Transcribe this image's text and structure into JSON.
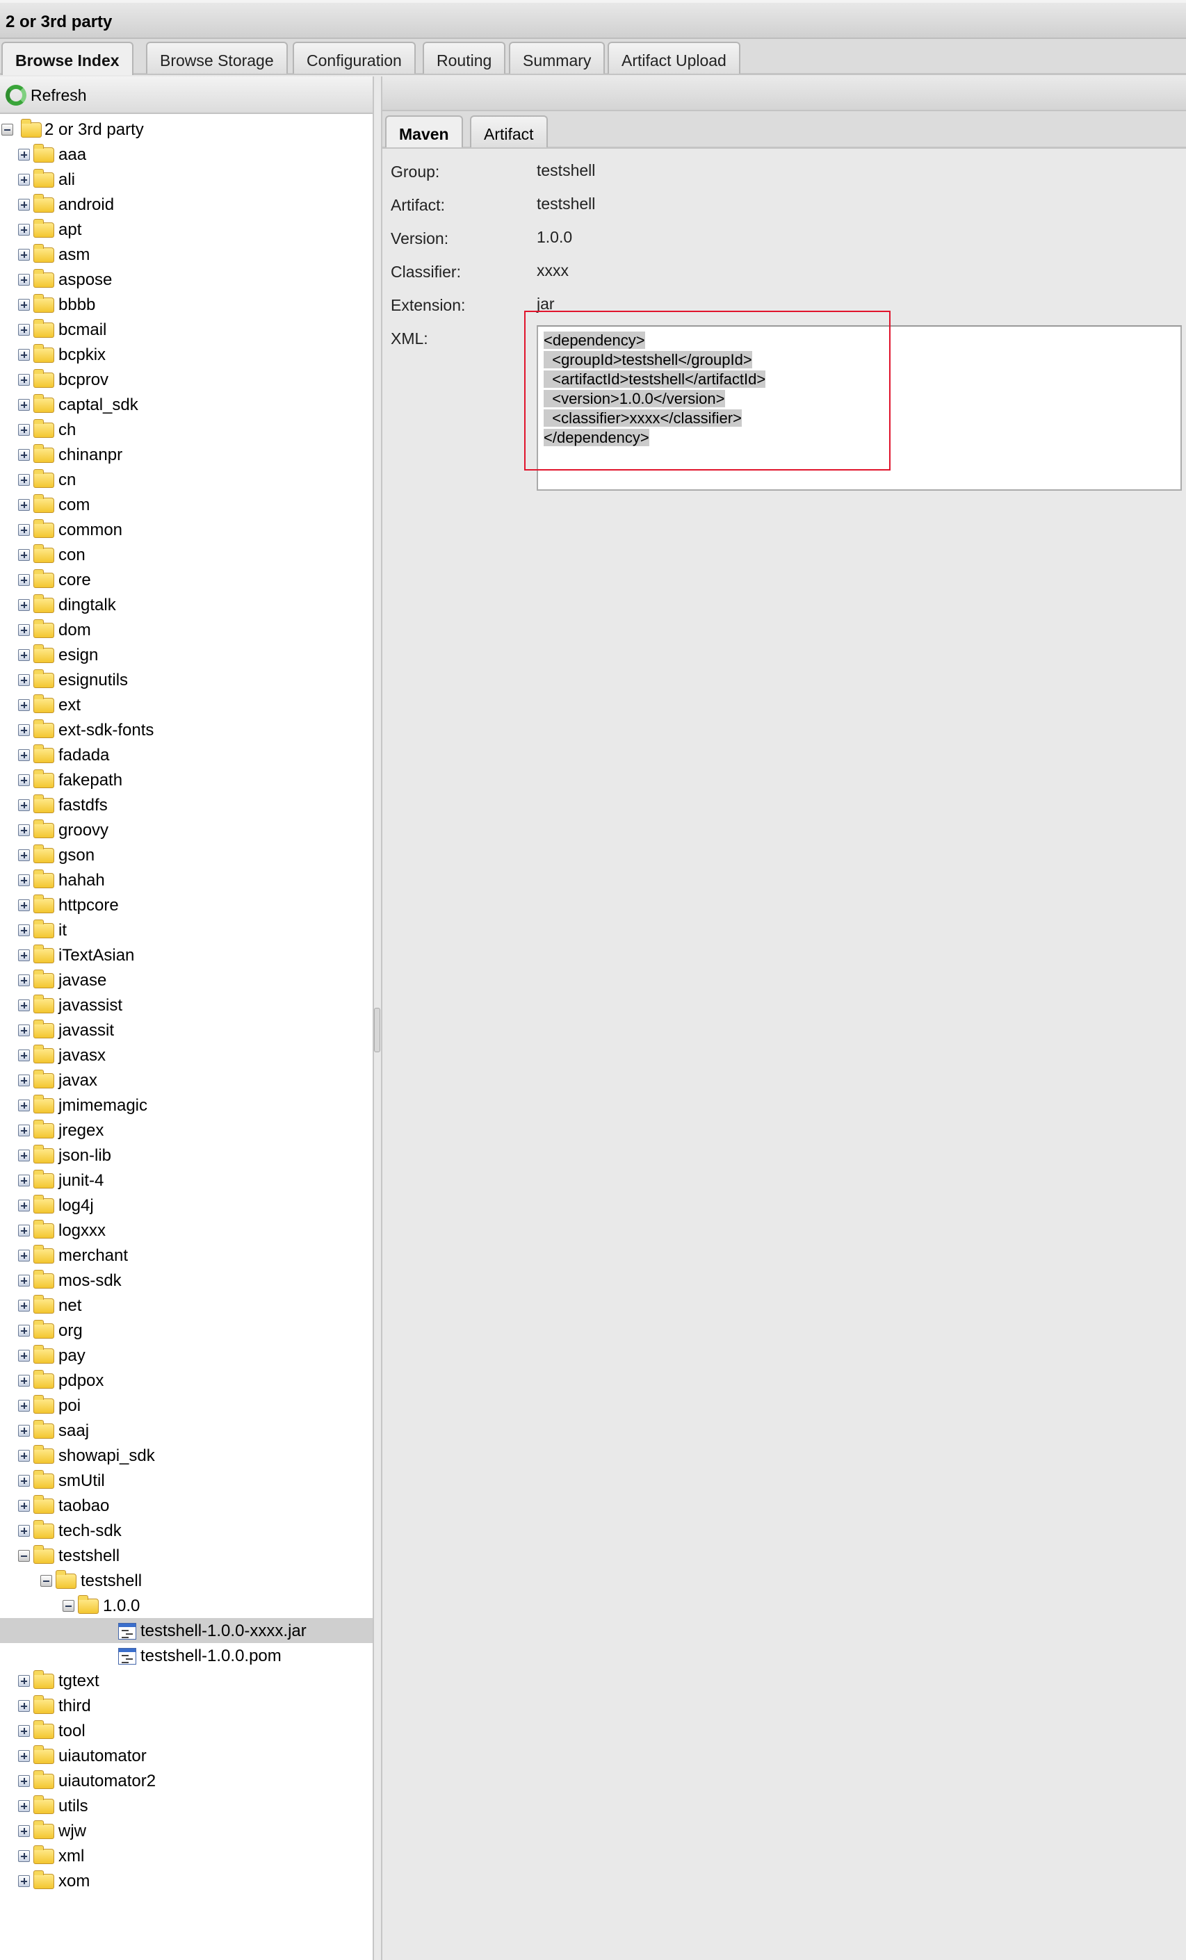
{
  "window": {
    "title": "2 or 3rd party"
  },
  "tabs": [
    {
      "label": "Browse Index",
      "active": true
    },
    {
      "label": "Browse Storage"
    },
    {
      "label": "Configuration"
    },
    {
      "label": "Routing"
    },
    {
      "label": "Summary"
    },
    {
      "label": "Artifact Upload"
    }
  ],
  "left": {
    "refresh_label": "Refresh",
    "refresh_icon": "refresh-icon"
  },
  "tree": [
    {
      "label": "2 or 3rd party",
      "level": 0,
      "type": "folder",
      "expanded": true
    },
    {
      "label": "aaa",
      "level": 1
    },
    {
      "label": "ali",
      "level": 1
    },
    {
      "label": "android",
      "level": 1
    },
    {
      "label": "apt",
      "level": 1
    },
    {
      "label": "asm",
      "level": 1
    },
    {
      "label": "aspose",
      "level": 1
    },
    {
      "label": "bbbb",
      "level": 1
    },
    {
      "label": "bcmail",
      "level": 1
    },
    {
      "label": "bcpkix",
      "level": 1
    },
    {
      "label": "bcprov",
      "level": 1
    },
    {
      "label": "captal_sdk",
      "level": 1
    },
    {
      "label": "ch",
      "level": 1
    },
    {
      "label": "chinanpr",
      "level": 1
    },
    {
      "label": "cn",
      "level": 1
    },
    {
      "label": "com",
      "level": 1
    },
    {
      "label": "common",
      "level": 1
    },
    {
      "label": "con",
      "level": 1
    },
    {
      "label": "core",
      "level": 1
    },
    {
      "label": "dingtalk",
      "level": 1
    },
    {
      "label": "dom",
      "level": 1
    },
    {
      "label": "esign",
      "level": 1
    },
    {
      "label": "esignutils",
      "level": 1
    },
    {
      "label": "ext",
      "level": 1
    },
    {
      "label": "ext-sdk-fonts",
      "level": 1
    },
    {
      "label": "fadada",
      "level": 1
    },
    {
      "label": "fakepath",
      "level": 1
    },
    {
      "label": "fastdfs",
      "level": 1
    },
    {
      "label": "groovy",
      "level": 1
    },
    {
      "label": "gson",
      "level": 1
    },
    {
      "label": "hahah",
      "level": 1
    },
    {
      "label": "httpcore",
      "level": 1
    },
    {
      "label": "it",
      "level": 1
    },
    {
      "label": "iTextAsian",
      "level": 1
    },
    {
      "label": "javase",
      "level": 1
    },
    {
      "label": "javassist",
      "level": 1
    },
    {
      "label": "javassit",
      "level": 1
    },
    {
      "label": "javasx",
      "level": 1
    },
    {
      "label": "javax",
      "level": 1
    },
    {
      "label": "jmimemagic",
      "level": 1
    },
    {
      "label": "jregex",
      "level": 1
    },
    {
      "label": "json-lib",
      "level": 1
    },
    {
      "label": "junit-4",
      "level": 1
    },
    {
      "label": "log4j",
      "level": 1
    },
    {
      "label": "logxxx",
      "level": 1
    },
    {
      "label": "merchant",
      "level": 1
    },
    {
      "label": "mos-sdk",
      "level": 1
    },
    {
      "label": "net",
      "level": 1
    },
    {
      "label": "org",
      "level": 1
    },
    {
      "label": "pay",
      "level": 1
    },
    {
      "label": "pdpox",
      "level": 1
    },
    {
      "label": "poi",
      "level": 1
    },
    {
      "label": "saaj",
      "level": 1
    },
    {
      "label": "showapi_sdk",
      "level": 1
    },
    {
      "label": "smUtil",
      "level": 1
    },
    {
      "label": "taobao",
      "level": 1
    },
    {
      "label": "tech-sdk",
      "level": 1
    },
    {
      "label": "testshell",
      "level": 1,
      "expanded": true
    },
    {
      "label": "testshell",
      "level": 2,
      "expanded": true
    },
    {
      "label": "1.0.0",
      "level": 3,
      "expanded": true
    },
    {
      "label": "testshell-1.0.0-xxxx.jar",
      "level": 4,
      "type": "file",
      "selected": true
    },
    {
      "label": "testshell-1.0.0.pom",
      "level": 4,
      "type": "file"
    },
    {
      "label": "tgtext",
      "level": 1
    },
    {
      "label": "third",
      "level": 1
    },
    {
      "label": "tool",
      "level": 1
    },
    {
      "label": "uiautomator",
      "level": 1
    },
    {
      "label": "uiautomator2",
      "level": 1
    },
    {
      "label": "utils",
      "level": 1
    },
    {
      "label": "wjw",
      "level": 1
    },
    {
      "label": "xml",
      "level": 1
    },
    {
      "label": "xom",
      "level": 1
    }
  ],
  "detail": {
    "tabs": [
      {
        "label": "Maven",
        "active": true
      },
      {
        "label": "Artifact"
      }
    ],
    "fields": [
      {
        "label": "Group:",
        "value": "testshell"
      },
      {
        "label": "Artifact:",
        "value": "testshell"
      },
      {
        "label": "Version:",
        "value": "1.0.0"
      },
      {
        "label": "Classifier:",
        "value": "xxxx"
      },
      {
        "label": "Extension:",
        "value": "jar"
      }
    ],
    "xml_label": "XML:",
    "xml_lines": [
      "<dependency>",
      "  <groupId>testshell</groupId>",
      "  <artifactId>testshell</artifactId>",
      "  <version>1.0.0</version>",
      "  <classifier>xxxx</classifier>",
      "</dependency>"
    ],
    "highlight_color": "#e0142c"
  }
}
